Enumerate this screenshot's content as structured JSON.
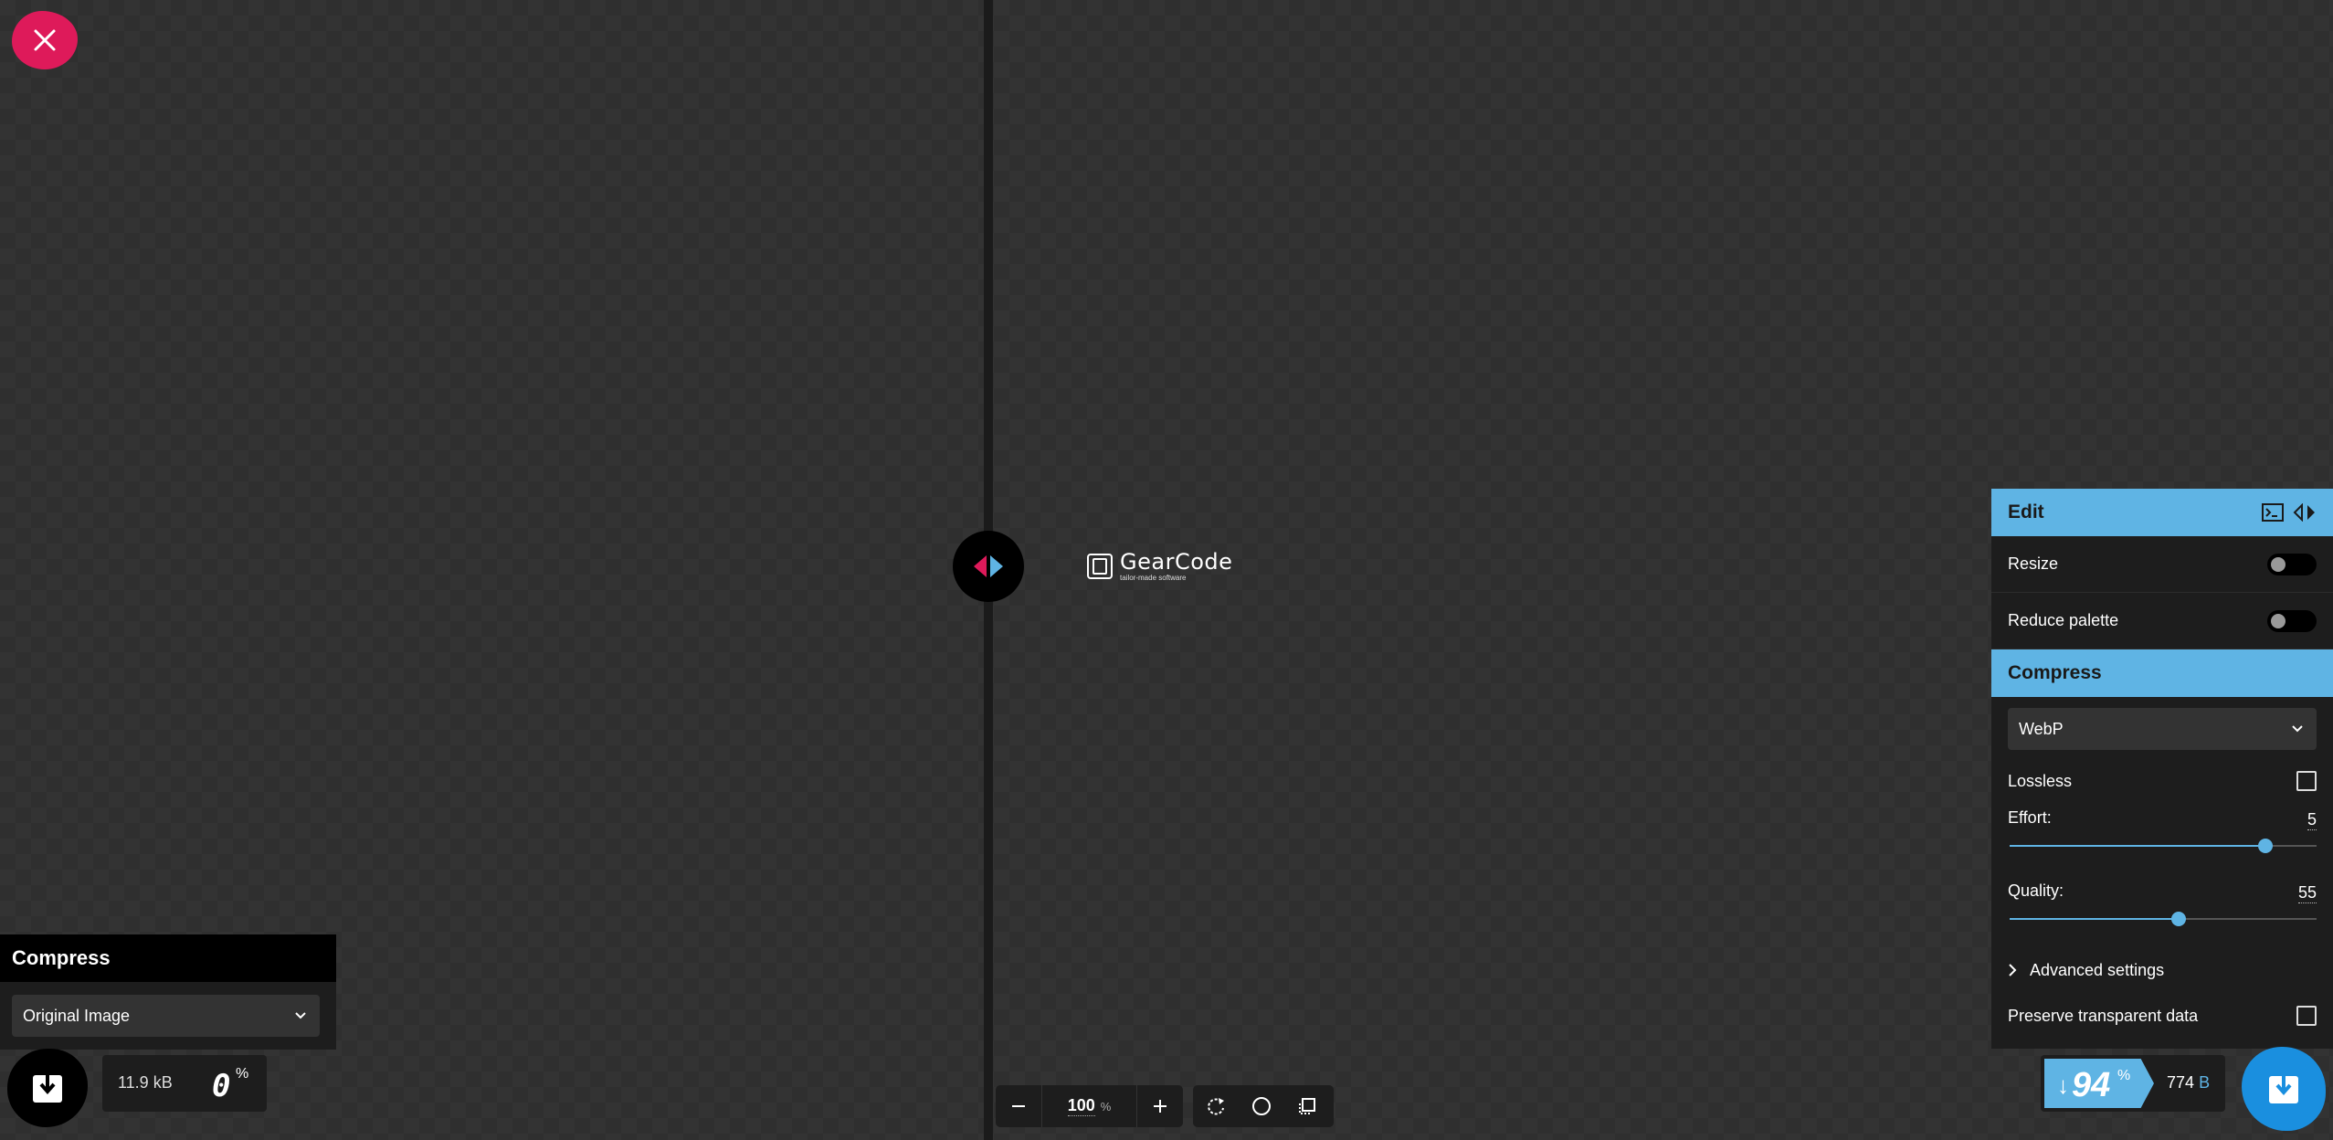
{
  "logo": {
    "name": "GearCode",
    "tagline": "tailor-made software"
  },
  "left_panel": {
    "title": "Compress",
    "method_select": "Original Image",
    "file_size": "11.9 kB",
    "percent": "0",
    "percent_sign": "%"
  },
  "zoom": {
    "value": "100",
    "unit": "%"
  },
  "edit_section": {
    "title": "Edit",
    "resize_label": "Resize",
    "resize_on": false,
    "reduce_palette_label": "Reduce palette",
    "reduce_palette_on": false
  },
  "compress_section": {
    "title": "Compress",
    "format_select": "WebP",
    "lossless_label": "Lossless",
    "lossless_checked": false,
    "effort_label": "Effort:",
    "effort_value": "5",
    "effort_min": 0,
    "effort_max": 6,
    "quality_label": "Quality:",
    "quality_value": "55",
    "quality_min": 0,
    "quality_max": 100,
    "advanced_label": "Advanced settings",
    "preserve_label": "Preserve transparent data",
    "preserve_checked": false
  },
  "right_result": {
    "arrow": "↓",
    "percent": "94",
    "percent_sign": "%",
    "size_value": "774",
    "size_unit": "B"
  },
  "colors": {
    "accent": "#5fb4e4",
    "close": "#de1a5a",
    "download_right": "#1a8fdf",
    "arrow_left": "#de1a5a",
    "arrow_right": "#5fb4e4"
  }
}
